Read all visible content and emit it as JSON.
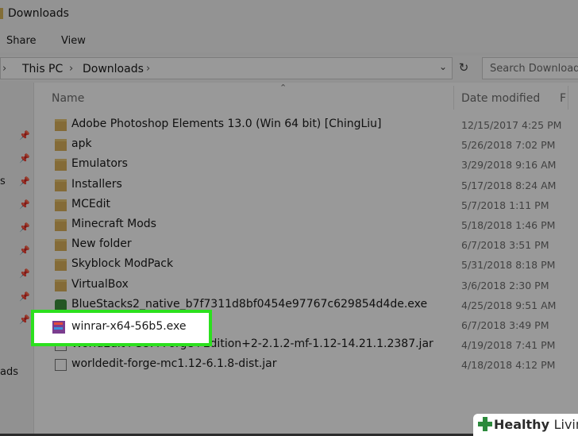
{
  "window": {
    "title": "Downloads"
  },
  "ribbon": {
    "tabs": [
      "Share",
      "View"
    ]
  },
  "address": {
    "crumbs": [
      "This PC",
      "Downloads"
    ],
    "search_placeholder": "Search Downloads"
  },
  "nav": {
    "fragments": [
      "s",
      "ads"
    ]
  },
  "columns": {
    "name": "Name",
    "date_modified": "Date modified",
    "next_col_fragment": "F"
  },
  "files": [
    {
      "name": "Adobe Photoshop Elements 13.0 (Win 64 bit) [ChingLiu]",
      "date": "12/15/2017 4:25 PM",
      "type": "folder"
    },
    {
      "name": "apk",
      "date": "5/26/2018 7:02 PM",
      "type": "folder"
    },
    {
      "name": "Emulators",
      "date": "3/29/2018 9:16 AM",
      "type": "folder"
    },
    {
      "name": "Installers",
      "date": "5/17/2018 8:24 AM",
      "type": "folder"
    },
    {
      "name": "MCEdit",
      "date": "5/7/2018 1:11 PM",
      "type": "folder"
    },
    {
      "name": "Minecraft Mods",
      "date": "5/18/2018 1:46 PM",
      "type": "folder"
    },
    {
      "name": "New folder",
      "date": "6/7/2018 3:51 PM",
      "type": "folder"
    },
    {
      "name": "Skyblock ModPack",
      "date": "5/31/2018 8:18 PM",
      "type": "folder"
    },
    {
      "name": "VirtualBox",
      "date": "3/6/2018 2:30 PM",
      "type": "folder"
    },
    {
      "name": "BlueStacks2_native_b7f7311d8bf0454e97767c629854d4de.exe",
      "date": "4/25/2018 9:51 AM",
      "type": "exe"
    },
    {
      "name": "winrar-x64-56b5.exe",
      "date": "6/7/2018 3:49 PM",
      "type": "rar"
    },
    {
      "name": "WorldEdit+CUI+Forge+Edition+2-2.1.2-mf-1.12-14.21.1.2387.jar",
      "date": "4/19/2018 7:41 PM",
      "type": "jar"
    },
    {
      "name": "worldedit-forge-mc1.12-6.1.8-dist.jar",
      "date": "4/18/2018 4:12 PM",
      "type": "jar"
    }
  ],
  "highlight": {
    "label": "winrar-x64-56b5.exe"
  },
  "watermark": {
    "brand_bold": "Healthy",
    "brand_light": "Living"
  },
  "colors": {
    "highlight_border": "#2ce01e",
    "folder": "#dcb35c"
  }
}
